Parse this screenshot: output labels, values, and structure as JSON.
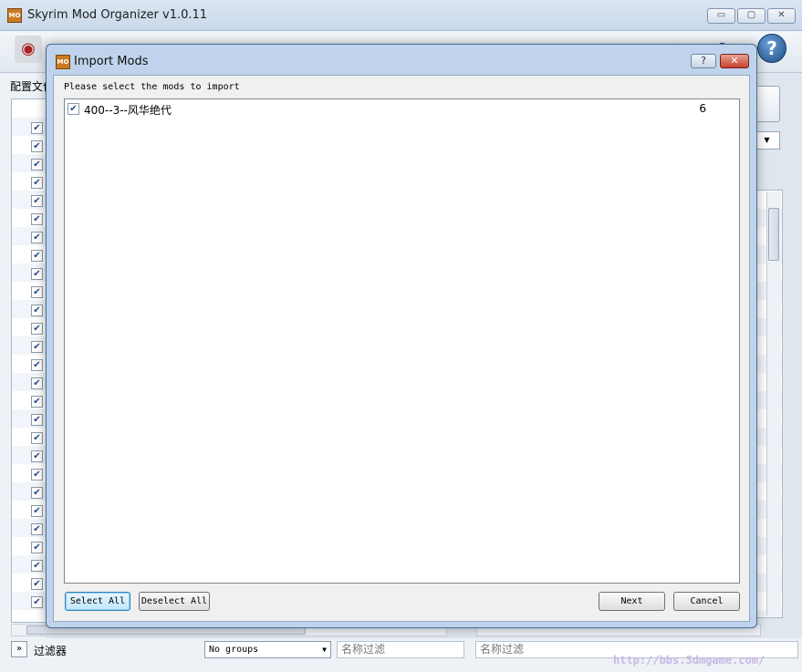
{
  "main_window": {
    "title": "Skyrim Mod Organizer v1.0.11",
    "app_icon_text": "MO",
    "controls": {
      "minimize": "▭",
      "restore": "▢",
      "close": "✕"
    },
    "profile_label": "配置文件",
    "help_icon_text": "?",
    "toolbar_icons": [
      "install-mod-icon",
      "nexus-icon",
      "profiles-icon",
      "executables-icon",
      "tools-icon",
      "settings-icon",
      "problems-icon",
      "update-icon",
      "help-icon"
    ],
    "bottom": {
      "expand": "»",
      "filter_label": "过滤器",
      "groups_select": "No groups",
      "name_filter_left_placeholder": "名称过滤",
      "name_filter_right_placeholder": "名称过滤"
    },
    "watermark": "http://bbs.3dmgame.com/"
  },
  "dialog": {
    "icon_text": "MO",
    "title": "Import Mods",
    "help_button": "?",
    "close_button": "✕",
    "instruction": "Please select the mods to import",
    "mods": [
      {
        "name": "400--3--风华绝代",
        "count": "6",
        "checked": true
      }
    ],
    "buttons": {
      "select_all": "Select All",
      "deselect_all": "Deselect All",
      "next": "Next",
      "cancel": "Cancel"
    }
  }
}
